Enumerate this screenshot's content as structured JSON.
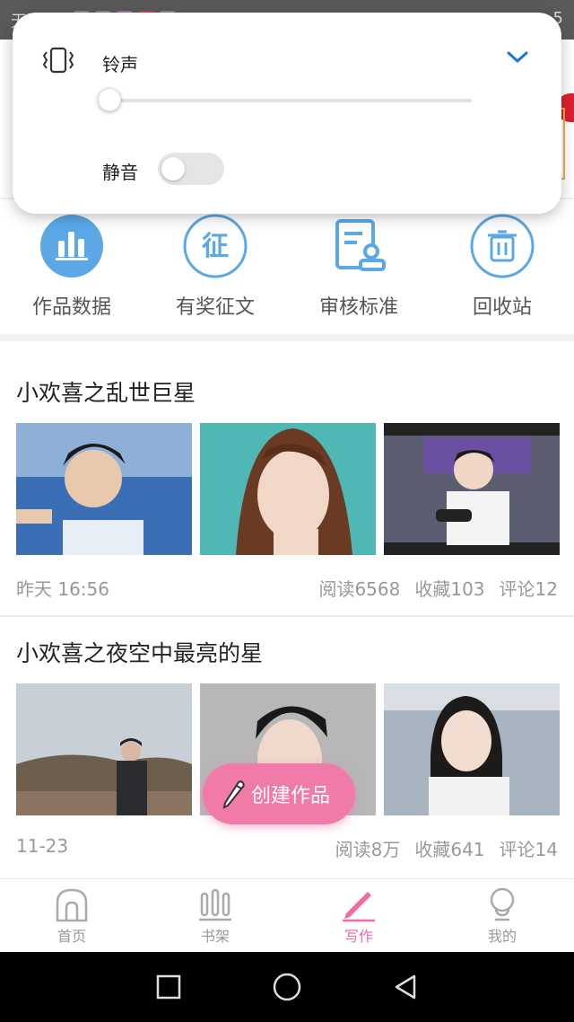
{
  "status_bar": {
    "left_text": "无",
    "right_text": "5"
  },
  "volume_panel": {
    "ringtone_label": "铃声",
    "ringtone_level": 0.0,
    "mute_label": "静音",
    "mute_on": false,
    "accent_color": "#1a73e8"
  },
  "quick_actions": [
    {
      "label": "作品数据",
      "icon": "bar-chart-icon"
    },
    {
      "label": "有奖征文",
      "icon": "contest-icon",
      "glyph": "征"
    },
    {
      "label": "审核标准",
      "icon": "review-doc-icon"
    },
    {
      "label": "回收站",
      "icon": "trash-icon"
    }
  ],
  "works": [
    {
      "title": "小欢喜之乱世巨星",
      "time": "昨天 16:56",
      "reads": "阅读6568",
      "favorites": "收藏103",
      "comments": "评论12"
    },
    {
      "title": "小欢喜之夜空中最亮的星",
      "time": "11-23",
      "reads": "阅读8万",
      "favorites": "收藏641",
      "comments": "评论14"
    }
  ],
  "fab": {
    "label": "创建作品"
  },
  "tabs": [
    {
      "label": "首页",
      "icon": "home-icon",
      "active": false
    },
    {
      "label": "书架",
      "icon": "bookshelf-icon",
      "active": false
    },
    {
      "label": "写作",
      "icon": "pencil-icon",
      "active": true
    },
    {
      "label": "我的",
      "icon": "profile-icon",
      "active": false
    }
  ],
  "colors": {
    "brand_pink": "#f06ba3",
    "icon_blue": "#5aa8e6"
  }
}
